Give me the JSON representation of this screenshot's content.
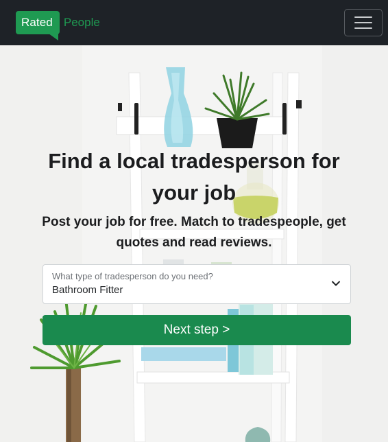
{
  "header": {
    "logo_part1": "Rated",
    "logo_part2": "People",
    "menu_icon": "hamburger-menu-icon"
  },
  "hero": {
    "title": "Find a local tradesperson for your job",
    "subtitle": "Post your job for free. Match to tradespeople, get quotes and read reviews.",
    "trade_select": {
      "label": "What type of tradesperson do you need?",
      "value": "Bathroom Fitter",
      "icon": "chevron-down-icon"
    },
    "next_button_label": "Next step >"
  },
  "colors": {
    "navbar_bg": "#1e2227",
    "brand_green": "#1f9a52",
    "button_green": "#1a8a4e"
  }
}
